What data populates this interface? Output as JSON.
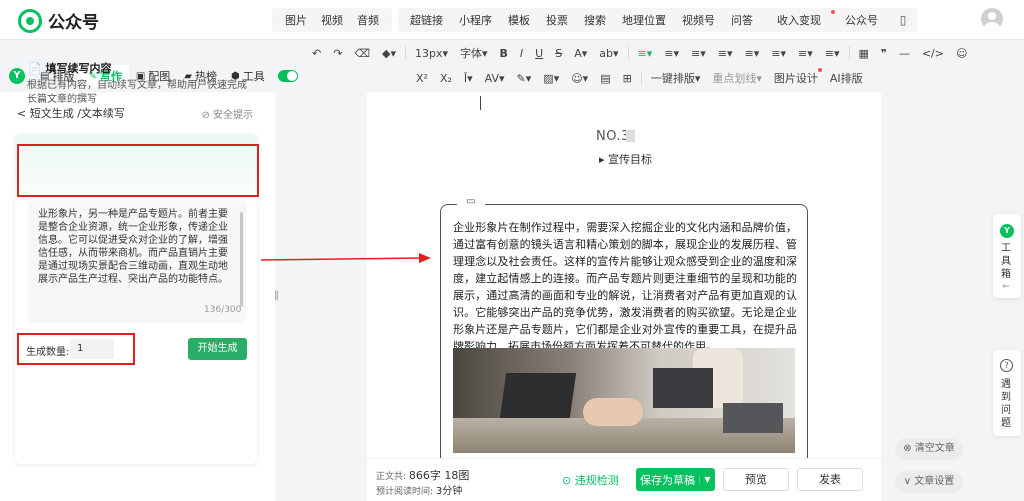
{
  "app": {
    "title": "公众号"
  },
  "insert_menu": {
    "group1": [
      "图片",
      "视频",
      "音频"
    ],
    "group2": [
      "超链接",
      "小程序",
      "模板",
      "投票",
      "搜索",
      "地理位置",
      "视频号",
      "问答",
      "收入变现",
      "公众号",
      "···"
    ]
  },
  "toolbar_row1": [
    "↶",
    "↷",
    "⌫",
    "◆▾",
    "13px▾",
    "字体▾",
    "B",
    "I",
    "U",
    "S",
    "A▾",
    "ab▾",
    "≡▾",
    "≡▾",
    "≡▾",
    "≡▾",
    "≡▾",
    "≡▾",
    "≡▾",
    "≡▾",
    "▦",
    "❞",
    "—",
    "</>",
    "☺"
  ],
  "toolbar_row2": [
    "X²",
    "X₂",
    "Ī▾",
    "AV▾",
    "✎▾",
    "▨▾",
    "☺▾",
    "▤",
    "⊞",
    "一键排版▾",
    "重点划线▾",
    "图片设计",
    "AI排版"
  ],
  "side_nav": {
    "brand": "Y",
    "tabs": [
      {
        "icon": "▤",
        "label": "排版"
      },
      {
        "icon": "✎",
        "label": "写作"
      },
      {
        "icon": "▣",
        "label": "配图"
      },
      {
        "icon": "▰",
        "label": "热榜"
      },
      {
        "icon": "⬢",
        "label": "工具"
      }
    ]
  },
  "left_panel": {
    "breadcrumb": "< 短文生成 /文本续写",
    "safety_tip": "⊘ 安全提示",
    "card_title": "📄 填写续写内容",
    "card_desc": "根据已有内容，自动续写文章，帮助用户快速完成长篇文章的撰写",
    "input_text": "业形象片，另一种是产品专题片。前者主要是整合企业资源，统一企业形象，传递企业信息。它可以促进受众对企业的了解，增强信任感，从而带来商机。而产品直销片主要是通过现场实景配合三维动画，直观生动地展示产品生产过程、突出产品的功能特点。",
    "char_counter": "136/300",
    "count_label": "生成数量:",
    "count_value": "1",
    "start_button": "开始生成"
  },
  "editor": {
    "section_no": "NO.3",
    "section_title": "▸ 宣传目标",
    "box_icon": "▭",
    "paragraph": "企业形象片在制作过程中，需要深入挖掘企业的文化内涵和品牌价值，通过富有创意的镜头语言和精心策划的脚本，展现企业的发展历程、管理理念以及社会责任。这样的宣传片能够让观众感受到企业的温度和深度，建立起情感上的连接。而产品专题片则更注重细节的呈现和功能的展示，通过高清的画面和专业的解说，让消费者对产品有更加直观的认识。它能够突出产品的竞争优势，激发消费者的购买欲望。无论是企业形象片还是产品专题片，它们都是企业对外宣传的重要工具，在提升品牌影响力、拓展市场份额方面发挥着不可替代的作用。"
  },
  "bottom_bar": {
    "word_count_label": "正文共:",
    "word_count": "866字 18图",
    "read_time_label": "预计阅读时间:",
    "read_time": "3分钟",
    "check": "⊙ 违规检测",
    "save": "保存为草稿",
    "save_dropdown": "▼",
    "preview": "预览",
    "publish": "发表"
  },
  "right_float": {
    "toolbox_icon": "Y",
    "toolbox_label": "工具箱",
    "toolbox_back": "⇐",
    "help_icon": "?",
    "help_label": "遇到问题",
    "clear": "⊗ 清空文章",
    "settings": "∨ 文章设置"
  },
  "colors": {
    "brand": "#07c160",
    "annotation": "#e02020"
  }
}
